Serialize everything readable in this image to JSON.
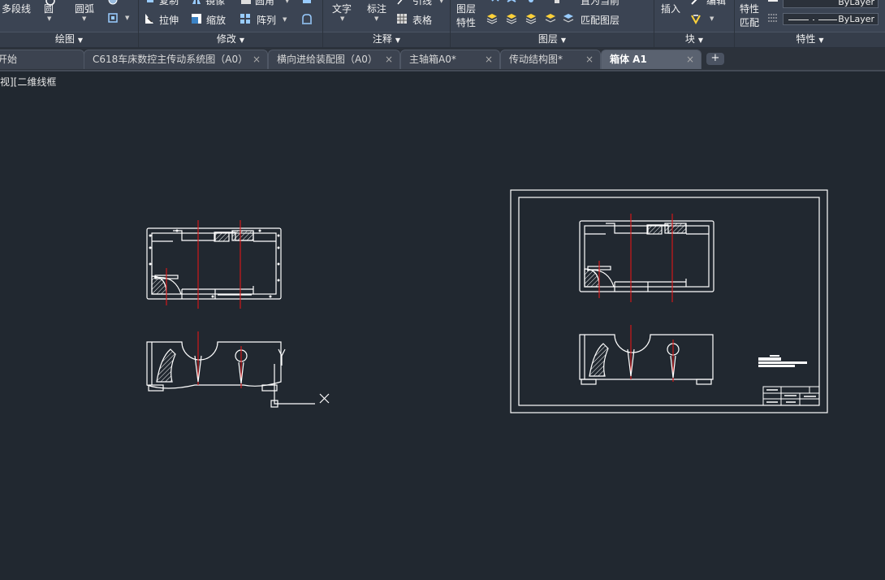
{
  "ribbon": {
    "draw": {
      "title": "绘图",
      "polyline": "多段线",
      "circle": "圆",
      "arc": "圆弧"
    },
    "modify": {
      "title": "修改",
      "copy": "复制",
      "mirror": "镜像",
      "fillet": "圆角",
      "stretch": "拉伸",
      "scale": "缩放",
      "array": "阵列"
    },
    "annotation": {
      "title": "注释",
      "text": "文字",
      "dimension": "标注",
      "leader": "引线",
      "table": "表格"
    },
    "layers": {
      "title": "图层",
      "layer_properties_line1": "图层",
      "layer_properties_line2": "特性",
      "set_current": "置为当前",
      "match_layer": "匹配图层"
    },
    "block": {
      "title": "块",
      "insert": "插入",
      "edit": "编辑"
    },
    "properties": {
      "title": "特性",
      "match_line1": "特性",
      "match_line2": "匹配",
      "color_value": "ByLayer",
      "linetype_value": "ByLayer"
    }
  },
  "tabs": [
    {
      "label": "开始",
      "active": false
    },
    {
      "label": "C618车床数控主传动系统图（A0）",
      "active": false
    },
    {
      "label": "横向进给装配图（A0）",
      "active": false
    },
    {
      "label": "主轴箱A0*",
      "active": false
    },
    {
      "label": "传动结构图*",
      "active": false
    },
    {
      "label": "箱体 A1",
      "active": true
    }
  ],
  "new_tab": "+",
  "close_glyph": "×",
  "viewport": {
    "label": "视][二维线框"
  },
  "colors": {
    "canvas_bg": "#212830",
    "ribbon_bg": "#3b4453",
    "line_white": "#ffffff",
    "centerline_red": "#e01616",
    "tab_active": "#5a6270"
  }
}
